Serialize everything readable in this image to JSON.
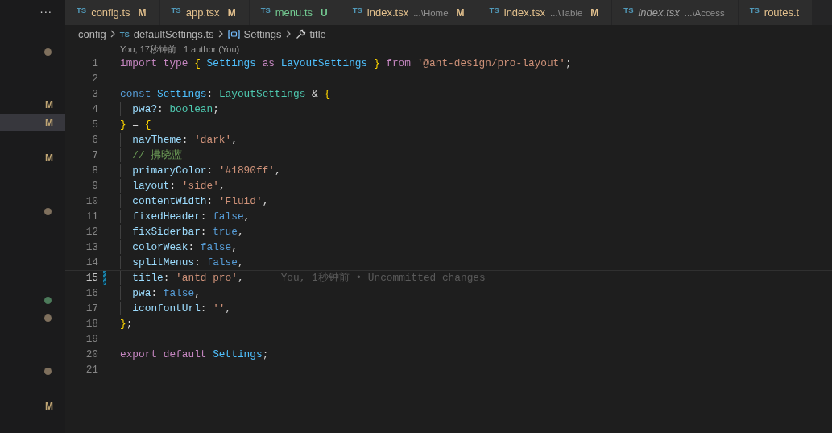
{
  "sidebar": {
    "more": "···",
    "rows": [
      {
        "kind": "empty",
        "selected": false
      },
      {
        "kind": "dot",
        "color": "#7f705d",
        "selected": false
      },
      {
        "kind": "empty",
        "selected": false
      },
      {
        "kind": "empty",
        "selected": false
      },
      {
        "kind": "letter",
        "text": "M",
        "selected": false
      },
      {
        "kind": "letter",
        "text": "M",
        "selected": true
      },
      {
        "kind": "empty",
        "selected": false
      },
      {
        "kind": "letter",
        "text": "M",
        "selected": false
      },
      {
        "kind": "empty",
        "selected": false
      },
      {
        "kind": "empty",
        "selected": false
      },
      {
        "kind": "dot",
        "color": "#7f705d",
        "selected": false
      },
      {
        "kind": "empty",
        "selected": false
      },
      {
        "kind": "empty",
        "selected": false
      },
      {
        "kind": "empty",
        "selected": false
      },
      {
        "kind": "empty",
        "selected": false
      },
      {
        "kind": "dot",
        "color": "#4c7a5a",
        "selected": false
      },
      {
        "kind": "dot",
        "color": "#7f705d",
        "selected": false
      },
      {
        "kind": "empty",
        "selected": false
      },
      {
        "kind": "empty",
        "selected": false
      },
      {
        "kind": "dot",
        "color": "#7f705d",
        "selected": false
      },
      {
        "kind": "empty",
        "selected": false
      },
      {
        "kind": "letter",
        "text": "M",
        "selected": false
      }
    ]
  },
  "tabs": [
    {
      "icon": "TS",
      "label": "config.ts",
      "kind": "modified",
      "badge": "M"
    },
    {
      "icon": "TS",
      "label": "app.tsx",
      "kind": "modified",
      "badge": "M"
    },
    {
      "icon": "TS",
      "label": "menu.ts",
      "kind": "untracked",
      "badge": "U"
    },
    {
      "icon": "TS",
      "label": "index.tsx",
      "description": "...\\Home",
      "kind": "modified",
      "badge": "M"
    },
    {
      "icon": "TS",
      "label": "index.tsx",
      "description": "...\\Table",
      "kind": "modified",
      "badge": "M"
    },
    {
      "icon": "TS",
      "label": "index.tsx",
      "description": "...\\Access",
      "kind": "preview"
    },
    {
      "icon": "TS",
      "label": "routes.t",
      "kind": "modified"
    }
  ],
  "breadcrumb": [
    {
      "kind": "folder",
      "text": "config"
    },
    {
      "kind": "file",
      "icon": "TS",
      "text": "defaultSettings.ts"
    },
    {
      "kind": "variable",
      "text": "Settings"
    },
    {
      "kind": "property",
      "text": "title"
    }
  ],
  "codelens": "You, 17秒钟前 | 1 author (You)",
  "lines": [
    {
      "number": "1",
      "indented": false,
      "current": false,
      "tokens": [
        {
          "kind": "keyword",
          "text": "import"
        },
        {
          "kind": "keyword",
          "text": " type"
        },
        {
          "kind": "brace",
          "text": " {"
        },
        {
          "kind": "variable",
          "text": " Settings"
        },
        {
          "kind": "keyword",
          "text": " as"
        },
        {
          "kind": "variable",
          "text": " LayoutSettings"
        },
        {
          "kind": "brace",
          "text": " }"
        },
        {
          "kind": "keyword",
          "text": " from"
        },
        {
          "kind": "string",
          "text": " '@ant-design/pro-layout'"
        },
        {
          "kind": "plain",
          "text": ";"
        }
      ]
    },
    {
      "number": "2",
      "indented": false,
      "current": false
    },
    {
      "number": "3",
      "indented": false,
      "current": false,
      "tokens": [
        {
          "kind": "storage",
          "text": "const"
        },
        {
          "kind": "variable",
          "text": " Settings"
        },
        {
          "kind": "plain",
          "text": ":"
        },
        {
          "kind": "type",
          "text": " LayoutSettings"
        },
        {
          "kind": "plain",
          "text": " &"
        },
        {
          "kind": "brace",
          "text": " {"
        }
      ]
    },
    {
      "number": "4",
      "indented": true,
      "current": false,
      "tokens": [
        {
          "kind": "property",
          "text": "pwa?"
        },
        {
          "kind": "plain",
          "text": ":"
        },
        {
          "kind": "type",
          "text": " boolean"
        },
        {
          "kind": "plain",
          "text": ";"
        }
      ]
    },
    {
      "number": "5",
      "indented": false,
      "current": false,
      "tokens": [
        {
          "kind": "brace",
          "text": "}"
        },
        {
          "kind": "plain",
          "text": " ="
        },
        {
          "kind": "brace",
          "text": " {"
        }
      ]
    },
    {
      "number": "6",
      "indented": true,
      "current": false,
      "tokens": [
        {
          "kind": "property",
          "text": "navTheme"
        },
        {
          "kind": "plain",
          "text": ":"
        },
        {
          "kind": "string",
          "text": " 'dark'"
        },
        {
          "kind": "plain",
          "text": ","
        }
      ]
    },
    {
      "number": "7",
      "indented": true,
      "current": false,
      "tokens": [
        {
          "kind": "comment",
          "text": "// 拂晓蓝"
        }
      ]
    },
    {
      "number": "8",
      "indented": true,
      "current": false,
      "tokens": [
        {
          "kind": "property",
          "text": "primaryColor"
        },
        {
          "kind": "plain",
          "text": ":"
        },
        {
          "kind": "string",
          "text": " '#1890ff'"
        },
        {
          "kind": "plain",
          "text": ","
        }
      ]
    },
    {
      "number": "9",
      "indented": true,
      "current": false,
      "tokens": [
        {
          "kind": "property",
          "text": "layout"
        },
        {
          "kind": "plain",
          "text": ":"
        },
        {
          "kind": "string",
          "text": " 'side'"
        },
        {
          "kind": "plain",
          "text": ","
        }
      ]
    },
    {
      "number": "10",
      "indented": true,
      "current": false,
      "tokens": [
        {
          "kind": "property",
          "text": "contentWidth"
        },
        {
          "kind": "plain",
          "text": ":"
        },
        {
          "kind": "string",
          "text": " 'Fluid'"
        },
        {
          "kind": "plain",
          "text": ","
        }
      ]
    },
    {
      "number": "11",
      "indented": true,
      "current": false,
      "tokens": [
        {
          "kind": "property",
          "text": "fixedHeader"
        },
        {
          "kind": "plain",
          "text": ":"
        },
        {
          "kind": "storage",
          "text": " false"
        },
        {
          "kind": "plain",
          "text": ","
        }
      ]
    },
    {
      "number": "12",
      "indented": true,
      "current": false,
      "tokens": [
        {
          "kind": "property",
          "text": "fixSiderbar"
        },
        {
          "kind": "plain",
          "text": ":"
        },
        {
          "kind": "storage",
          "text": " true"
        },
        {
          "kind": "plain",
          "text": ","
        }
      ]
    },
    {
      "number": "13",
      "indented": true,
      "current": false,
      "tokens": [
        {
          "kind": "property",
          "text": "colorWeak"
        },
        {
          "kind": "plain",
          "text": ":"
        },
        {
          "kind": "storage",
          "text": " false"
        },
        {
          "kind": "plain",
          "text": ","
        }
      ]
    },
    {
      "number": "14",
      "indented": true,
      "current": false,
      "tokens": [
        {
          "kind": "property",
          "text": "splitMenus"
        },
        {
          "kind": "plain",
          "text": ":"
        },
        {
          "kind": "storage",
          "text": " false"
        },
        {
          "kind": "plain",
          "text": ","
        }
      ]
    },
    {
      "number": "15",
      "indented": true,
      "current": true,
      "changed": true,
      "blame": "You, 1秒钟前 • Uncommitted changes",
      "tokens": [
        {
          "kind": "property",
          "text": "title"
        },
        {
          "kind": "plain",
          "text": ":"
        },
        {
          "kind": "string",
          "text": " 'antd pro'"
        },
        {
          "kind": "plain",
          "text": ","
        }
      ]
    },
    {
      "number": "16",
      "indented": true,
      "current": false,
      "tokens": [
        {
          "kind": "property",
          "text": "pwa"
        },
        {
          "kind": "plain",
          "text": ":"
        },
        {
          "kind": "storage",
          "text": " false"
        },
        {
          "kind": "plain",
          "text": ","
        }
      ]
    },
    {
      "number": "17",
      "indented": true,
      "current": false,
      "tokens": [
        {
          "kind": "property",
          "text": "iconfontUrl"
        },
        {
          "kind": "plain",
          "text": ":"
        },
        {
          "kind": "string",
          "text": " ''"
        },
        {
          "kind": "plain",
          "text": ","
        }
      ]
    },
    {
      "number": "18",
      "indented": false,
      "current": false,
      "tokens": [
        {
          "kind": "brace",
          "text": "}"
        },
        {
          "kind": "plain",
          "text": ";"
        }
      ]
    },
    {
      "number": "19",
      "indented": false,
      "current": false
    },
    {
      "number": "20",
      "indented": false,
      "current": false,
      "tokens": [
        {
          "kind": "keyword",
          "text": "export"
        },
        {
          "kind": "keyword",
          "text": " default"
        },
        {
          "kind": "variable",
          "text": " Settings"
        },
        {
          "kind": "plain",
          "text": ";"
        }
      ]
    },
    {
      "number": "21",
      "indented": false,
      "current": false
    }
  ]
}
